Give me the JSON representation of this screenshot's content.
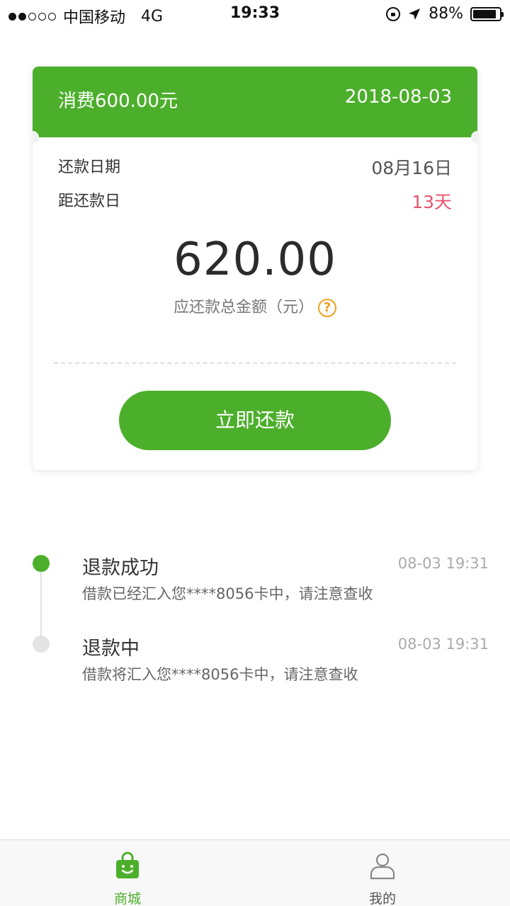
{
  "status_bar": {
    "carrier": "中国移动",
    "network": "4G",
    "time": "19:33",
    "battery": "88%",
    "battery_level": 0.88
  },
  "card": {
    "spend_label": "消费600.00元",
    "spend_date": "2018-08-03",
    "repay_date_label": "还款日期",
    "repay_date_value": "08月16日",
    "days_left_label": "距还款日",
    "days_left_value": "13天",
    "amount": "620.00",
    "amount_label": "应还款总金额（元）",
    "help_icon": "question-circle-icon",
    "repay_button": "立即还款"
  },
  "timeline": {
    "items": [
      {
        "title": "退款成功",
        "time": "08-03 19:31",
        "desc": "借款已经汇入您****8056卡中，请注意查收",
        "status": "done"
      },
      {
        "title": "退款中",
        "time": "08-03 19:31",
        "desc": "借款将汇入您****8056卡中，请注意查收",
        "status": "pending"
      }
    ]
  },
  "tab_bar": {
    "tabs": [
      {
        "label": "商城",
        "icon": "shopping-bag-icon",
        "active": true
      },
      {
        "label": "我的",
        "icon": "user-icon",
        "active": false
      }
    ]
  },
  "colors": {
    "primary_green": "#4caf2b",
    "alert_red": "#e8546d",
    "help_orange": "#f0a020"
  }
}
